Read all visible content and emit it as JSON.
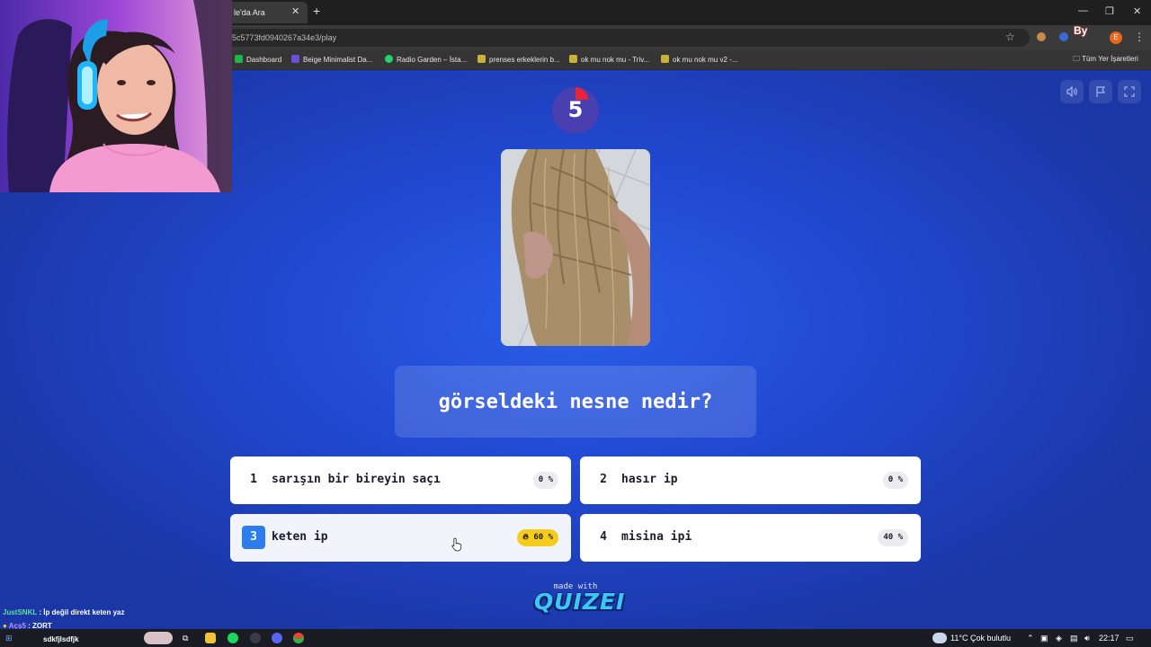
{
  "browser": {
    "tab_title": "le'da Ara",
    "tab_close": "✕",
    "new_tab": "+",
    "url": "5c5773fd0940267a34e3/play",
    "bookmarks": [
      {
        "label": "Dashboard",
        "color": "#1fb34c"
      },
      {
        "label": "Beige Minimalist Da...",
        "color": "#6b4fd8"
      },
      {
        "label": "Radio Garden – İsta...",
        "color": "#22d36b"
      },
      {
        "label": "prenses erkeklerin b...",
        "color": "#c9b23a"
      },
      {
        "label": "ok mu nok mu - Triv...",
        "color": "#c9b23a"
      },
      {
        "label": "ok mu nok mu v2 -...",
        "color": "#c9b23a"
      }
    ],
    "bookmarks_folder": "Tüm Yer İşaretleri",
    "extension_badge": "By",
    "profile_initial": "E"
  },
  "quiz": {
    "timer": "5",
    "question": "görseldeki nesne nedir?",
    "answers": [
      {
        "num": "1",
        "text": "sarışın bir bireyin saçı",
        "pct": "0 %"
      },
      {
        "num": "2",
        "text": "hasır ip",
        "pct": "0 %"
      },
      {
        "num": "3",
        "text": "keten ip",
        "pct": "60 %",
        "selected": true
      },
      {
        "num": "4",
        "text": "misina ipi",
        "pct": "40 %"
      }
    ],
    "made_with": "made with",
    "brand": "QUIZEI"
  },
  "chat": [
    {
      "user": "JustSNKL",
      "message": ": İp değil direkt keten yaz"
    },
    {
      "user": "Açş5",
      "message": ": ZORT"
    },
    {
      "user": "",
      "message": "sdkfjlsdfjk"
    }
  ],
  "taskbar": {
    "weather": "11°C  Çok bulutlu",
    "time": "22:17"
  },
  "colors": {
    "page_bg": "#2149d2",
    "selected_accent": "#2d7cf0",
    "winner_badge": "#f5cc1c",
    "timer_ring": "#e8243c"
  }
}
